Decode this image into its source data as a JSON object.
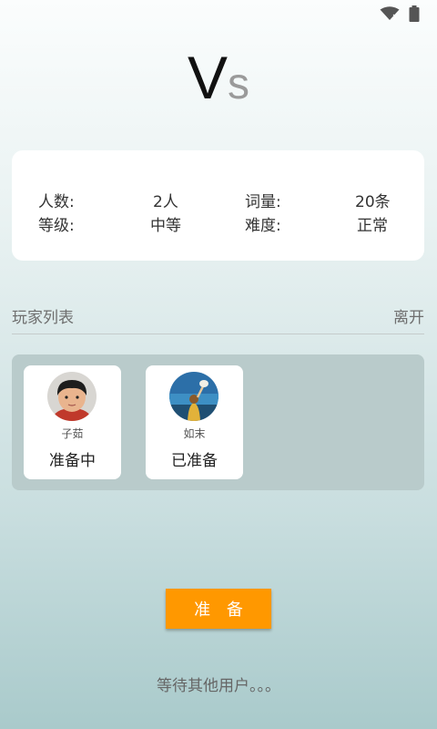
{
  "status_bar": {
    "icons": [
      "wifi-icon",
      "battery-icon"
    ]
  },
  "title": {
    "v": "V",
    "s": "s"
  },
  "game_info": {
    "player_count_label": "人数:",
    "player_count_value": "2人",
    "word_count_label": "词量:",
    "word_count_value": "20条",
    "level_label": "等级:",
    "level_value": "中等",
    "difficulty_label": "难度:",
    "difficulty_value": "正常"
  },
  "player_list_header": {
    "title": "玩家列表",
    "leave_label": "离开"
  },
  "players": [
    {
      "name": "子茹",
      "status": "准备中",
      "avatar": "child-portrait"
    },
    {
      "name": "如末",
      "status": "已准备",
      "avatar": "beach-photo"
    }
  ],
  "ready_button": {
    "label": "准 备"
  },
  "waiting_text": "等待其他用户。。。",
  "colors": {
    "accent": "#ff9800",
    "list_bg": "#b9cbcb"
  }
}
